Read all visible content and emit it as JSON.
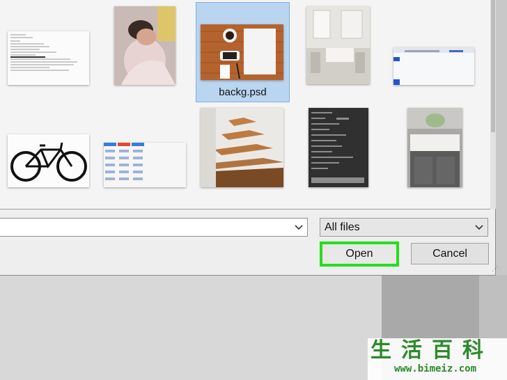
{
  "file_dialog": {
    "selected_file": "backg.psd",
    "file_type": "All files",
    "file_name_value": "",
    "open_label": "Open",
    "cancel_label": "Cancel"
  },
  "thumbnails": [
    {
      "name": "document-thumbnail"
    },
    {
      "name": "baby-photo-thumbnail"
    },
    {
      "name": "desk-photo-thumbnail"
    },
    {
      "name": "kitchen-photo-thumbnail"
    },
    {
      "name": "screenshot-thumbnail"
    },
    {
      "name": "bicycle-photo-thumbnail"
    },
    {
      "name": "table-image-thumbnail"
    },
    {
      "name": "stairs-photo-thumbnail"
    },
    {
      "name": "settings-screenshot-thumbnail"
    },
    {
      "name": "sink-photo-thumbnail"
    }
  ],
  "watermark": {
    "chars": "生活百科",
    "url": "www.bimeiz.com"
  },
  "colors": {
    "selection": "#b9d5f0",
    "highlight_border": "#22e01b",
    "watermark": "#2c8a2a"
  }
}
